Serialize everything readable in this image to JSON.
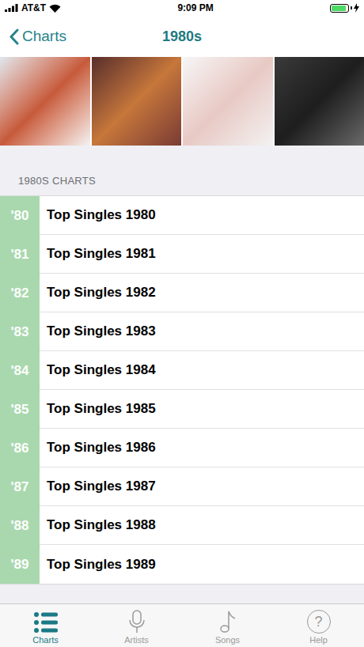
{
  "status_bar": {
    "carrier": "AT&T",
    "time": "9:09 PM",
    "battery_level": 0.92,
    "charging": true
  },
  "nav": {
    "back": "Charts",
    "title": "1980s"
  },
  "images": [
    {
      "kind": "photo"
    },
    {
      "kind": "photo"
    },
    {
      "kind": "photo"
    },
    {
      "kind": "photo"
    }
  ],
  "section": {
    "title": "1980S CHARTS"
  },
  "rows": [
    {
      "badge": "'80",
      "title": "Top Singles 1980"
    },
    {
      "badge": "'81",
      "title": "Top Singles 1981"
    },
    {
      "badge": "'82",
      "title": "Top Singles 1982"
    },
    {
      "badge": "'83",
      "title": "Top Singles 1983"
    },
    {
      "badge": "'84",
      "title": "Top Singles 1984"
    },
    {
      "badge": "'85",
      "title": "Top Singles 1985"
    },
    {
      "badge": "'86",
      "title": "Top Singles 1986"
    },
    {
      "badge": "'87",
      "title": "Top Singles 1987"
    },
    {
      "badge": "'88",
      "title": "Top Singles 1988"
    },
    {
      "badge": "'89",
      "title": "Top Singles 1989"
    }
  ],
  "tabs": [
    {
      "label": "Charts",
      "selected": true,
      "kind": "list"
    },
    {
      "label": "Artists",
      "selected": false,
      "kind": "mic"
    },
    {
      "label": "Songs",
      "selected": false,
      "kind": "note"
    },
    {
      "label": "Help",
      "selected": false,
      "kind": "help",
      "glyph": "?"
    }
  ]
}
